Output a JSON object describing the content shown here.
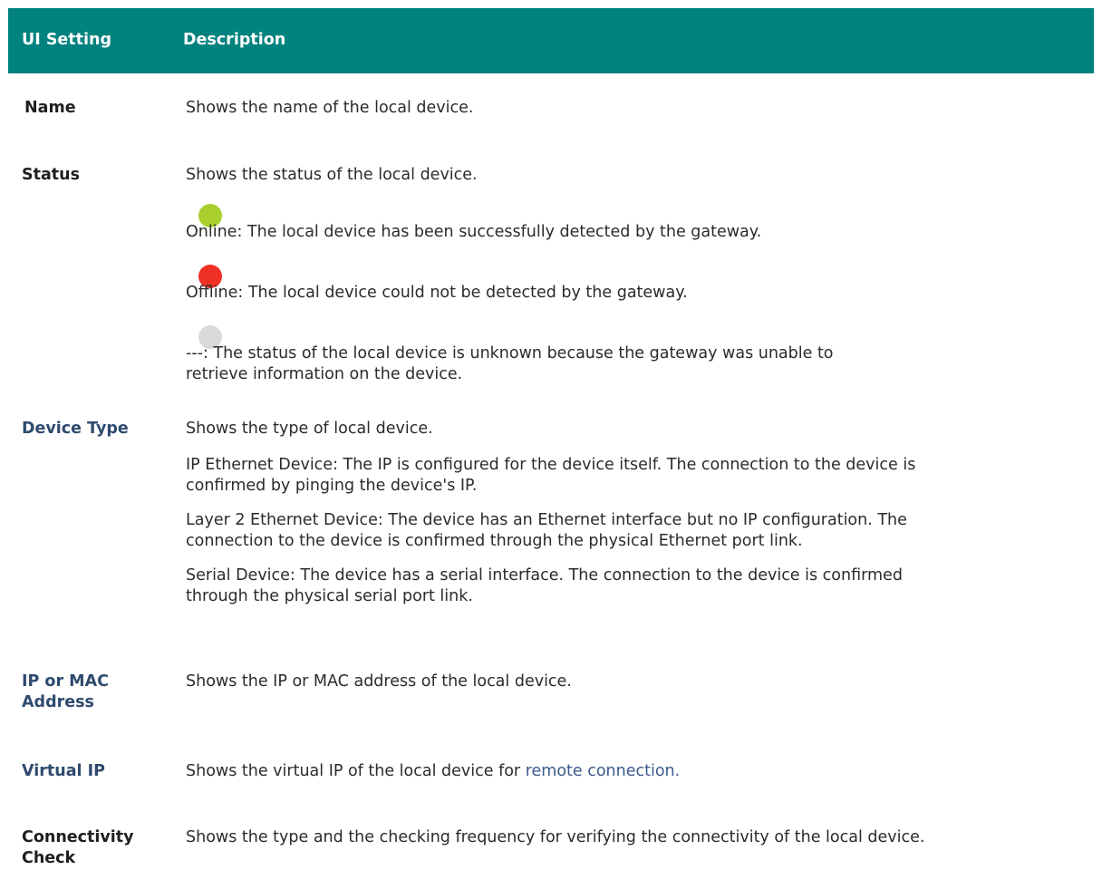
{
  "header": {
    "col1": "UI Setting",
    "col2": "Description"
  },
  "rows": {
    "name": {
      "label": "Name",
      "desc": "Shows the name of the local device."
    },
    "status": {
      "label": "Status",
      "desc": "Shows the status of the local device.",
      "items": [
        {
          "text": "Online: The local device has been successfully detected by the gateway.",
          "color": "#a8cf2e"
        },
        {
          "text": "Offline: The local device could not be detected by the gateway.",
          "color": "#ee3124"
        },
        {
          "text_line1": "---: The status of the local device is unknown because the gateway was unable to",
          "text_line2": "retrieve information on the device.",
          "color": "#d9d9d9"
        }
      ]
    },
    "device_type": {
      "label": "Device Type",
      "desc": "Shows the type of local device.",
      "paras": [
        {
          "line1": "IP Ethernet Device: The IP is configured for the device itself. The connection to the device is",
          "line2": "confirmed by pinging the device's IP."
        },
        {
          "line1": "Layer 2 Ethernet Device: The device has an Ethernet interface but no IP configuration. The",
          "line2": "connection to the device is confirmed through the physical Ethernet port link."
        },
        {
          "line1": "Serial Device: The device has a serial interface. The connection to the device is confirmed",
          "line2": "through the physical serial port link."
        }
      ]
    },
    "ip_mac": {
      "label_line1": "IP or MAC",
      "label_line2": "Address",
      "desc": "Shows the IP or MAC address of the local device."
    },
    "virtual_ip": {
      "label": "Virtual IP",
      "desc": "Shows the virtual IP of the local device for ",
      "link": "remote connection."
    },
    "connectivity": {
      "label_line1": "Connectivity",
      "label_line2": "Check",
      "desc": "Shows the type and the checking frequency for verifying the connectivity of the local device."
    }
  }
}
